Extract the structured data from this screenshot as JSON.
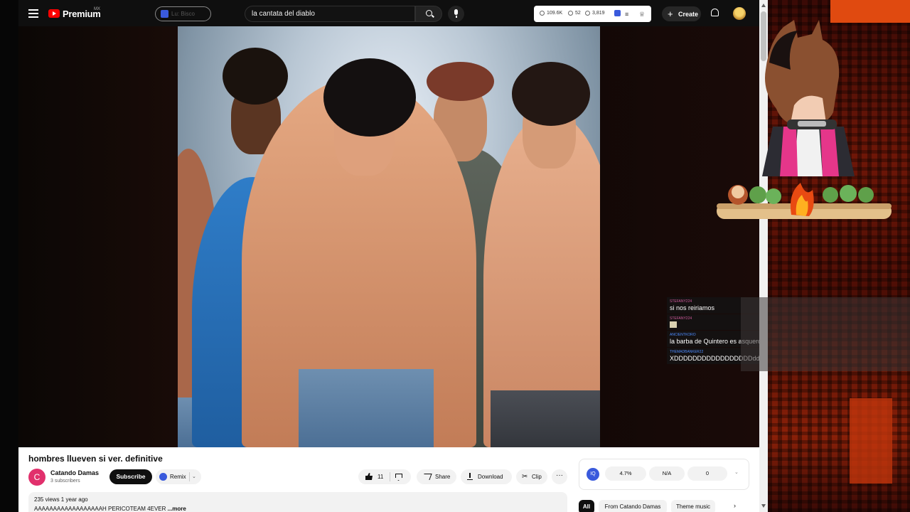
{
  "header": {
    "logo_text": "Premium",
    "logo_region": "MX",
    "extension_pill": "Lu: Bisco",
    "search_query": "la cantata del diablo",
    "stats": {
      "views": "109.6K",
      "likes": "52",
      "comments": "3,819"
    },
    "create_label": "Create",
    "icons": {
      "menu": "hamburger-menu-icon",
      "search": "search-icon",
      "mic": "microphone-icon",
      "bell": "bell-icon"
    }
  },
  "video": {
    "title": "hombres llueven si ver. definitive"
  },
  "channel": {
    "avatar_letter": "C",
    "name": "Catando Damas",
    "subscribers": "3 subscribers",
    "subscribe_label": "Subscribe",
    "remix_label": "Remix"
  },
  "actions": {
    "like_count": "11",
    "share_label": "Share",
    "download_label": "Download",
    "clip_label": "Clip",
    "more_label": "···"
  },
  "description": {
    "meta": "235 views  1 year ago",
    "text": "AAAAAAAAAAAAAAAAAAH PERICOTEAM 4EVER",
    "more": "...more"
  },
  "extension_widget": {
    "icon_text": "IQ",
    "cell1": "4.7%",
    "cell2": "N/A",
    "cell3": "0"
  },
  "chips": {
    "items": [
      "All",
      "From Catando Damas",
      "Theme music"
    ],
    "active_index": 0
  },
  "stream_chat": {
    "messages": [
      {
        "user": "STEFANY224",
        "text": "si nos reiriamos"
      },
      {
        "user": "STEFANY224",
        "text": ""
      },
      {
        "user": "ANCIENTKORO",
        "text": "la barba de Quintero es asquerosa"
      },
      {
        "user": "THEMADBANKER22",
        "text": "XDDDDDDDDDDDDDDDDDdd"
      }
    ]
  },
  "colors": {
    "yt_red": "#ff0000",
    "topbar": "#0f0f0f",
    "accent_blue": "#3a5adc",
    "stream_bg": "#6e1607"
  }
}
